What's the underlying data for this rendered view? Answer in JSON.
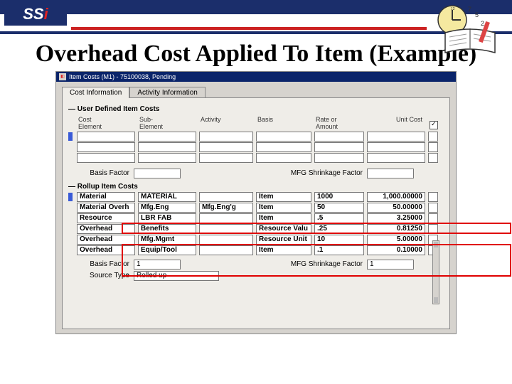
{
  "header": {
    "logo": "SS",
    "logo_i": "i"
  },
  "title": "Overhead Cost Applied To Item (Example)",
  "window": {
    "title": "Item Costs (M1) - 75100038, Pending"
  },
  "tabs": [
    {
      "label": "Cost Information",
      "active": true
    },
    {
      "label": "Activity Information",
      "active": false
    }
  ],
  "groups": {
    "user_defined": {
      "label": "User Defined Item Costs",
      "columns": {
        "c1": "Cost\nElement",
        "c2": "Sub-\nElement",
        "c3": "Activity",
        "c4": "Basis",
        "c5": "Rate or\nAmount",
        "c6": "Unit Cost"
      },
      "empty_rows": 3,
      "basis_factor_label": "Basis Factor",
      "basis_factor_value": "",
      "shrinkage_label": "MFG Shrinkage Factor",
      "shrinkage_value": ""
    },
    "rollup": {
      "label": "Rollup Item Costs",
      "rows": [
        {
          "c1": "Material",
          "c2": "MATERIAL",
          "c3": "",
          "c4": "Item",
          "c5": "1000",
          "c6": "1,000.00000"
        },
        {
          "c1": "Material Overh",
          "c2": "Mfg.Eng",
          "c3": "Mfg.Eng'g",
          "c4": "Item",
          "c5": "50",
          "c6": "50.00000"
        },
        {
          "c1": "Resource",
          "c2": "LBR FAB",
          "c3": "",
          "c4": "Item",
          "c5": ".5",
          "c6": "3.25000"
        },
        {
          "c1": "Overhead",
          "c2": "Benefits",
          "c3": "",
          "c4": "Resource Valu",
          "c5": ".25",
          "c6": "0.81250"
        },
        {
          "c1": "Overhead",
          "c2": "Mfg.Mgmt",
          "c3": "",
          "c4": "Resource Unit",
          "c5": "10",
          "c6": "5.00000"
        },
        {
          "c1": "Overhead",
          "c2": "Equip/Tool",
          "c3": "",
          "c4": "Item",
          "c5": ".1",
          "c6": "0.10000"
        }
      ],
      "basis_factor_label": "Basis Factor",
      "basis_factor_value": "1",
      "shrinkage_label": "MFG Shrinkage Factor",
      "shrinkage_value": "1",
      "source_type_label": "Source Type",
      "source_type_value": "Rolled up"
    }
  }
}
